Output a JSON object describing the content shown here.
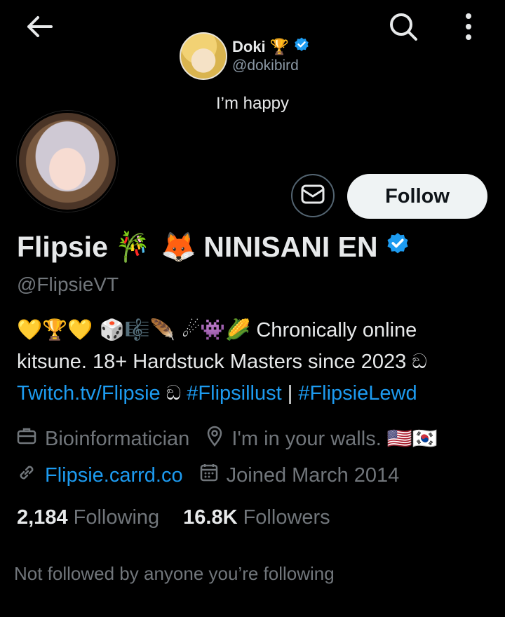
{
  "header": {
    "back_icon": "arrow-left-icon",
    "search_icon": "search-icon",
    "more_icon": "more-vertical-icon",
    "pinned_user": {
      "name": "Doki",
      "name_badge": "🏆",
      "handle": "@dokibird"
    },
    "status_text": "I’m happy"
  },
  "actions": {
    "message_icon": "mail-icon",
    "follow_label": "Follow"
  },
  "profile": {
    "name_text": "Flipsie",
    "name_emojis": "🎋 🦊",
    "name_suffix": "NINISANI EN",
    "handle": "@FlipsieVT",
    "verified_color": "#1d9bf0"
  },
  "bio": {
    "line1_emojis": "💛🏆💛   🎲🎼🪶   ☄👾🌽",
    "line1_text": " Chronically online",
    "line2_text": "kitsune. 18+ Hardstuck Masters since 2023  ඞ",
    "link1": "Twitch.tv/Flipsie",
    "sep1": " ඞ ",
    "tag1": "#Flipsillust",
    "sep2": " | ",
    "tag2": "#FlipsieLewd"
  },
  "meta": {
    "profession": "Bioinformatician",
    "location": "I'm in your walls. 🇺🇸🇰🇷",
    "website": "Flipsie.carrd.co",
    "joined": "Joined March 2014"
  },
  "stats": {
    "following_count": "2,184",
    "following_label": "Following",
    "followers_count": "16.8K",
    "followers_label": "Followers"
  },
  "note": "Not followed by anyone you’re following",
  "colors": {
    "background": "#000000",
    "text": "#e7e9ea",
    "muted": "#71767b",
    "link": "#1d9bf0",
    "follow_button_bg": "#eff3f4"
  }
}
